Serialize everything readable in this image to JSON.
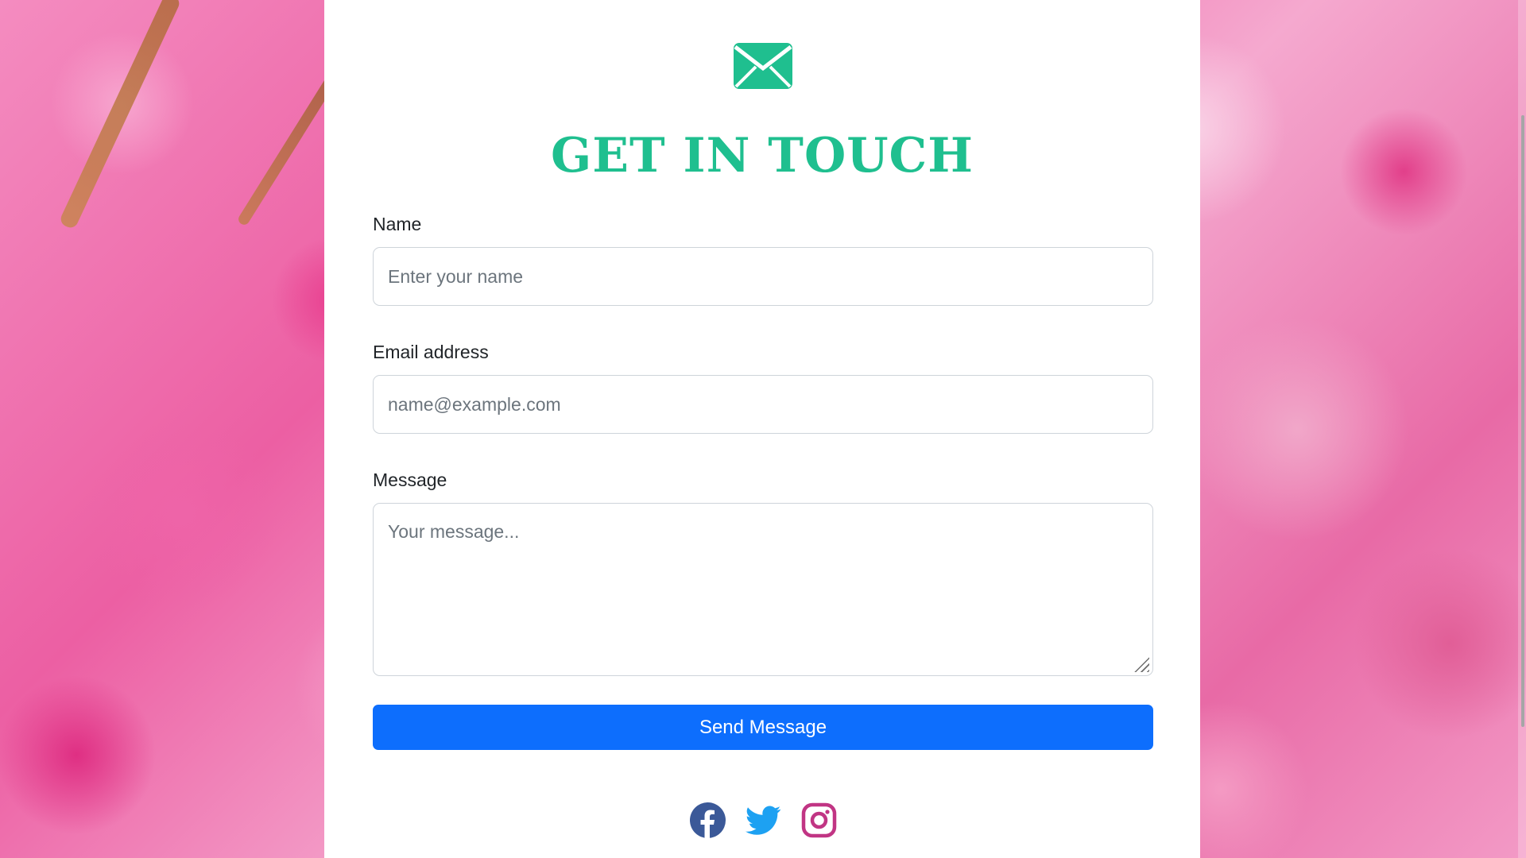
{
  "header": {
    "title": "GET IN TOUCH",
    "icon": "envelope-icon",
    "accent": "#1fbf8f"
  },
  "form": {
    "name": {
      "label": "Name",
      "placeholder": "Enter your name"
    },
    "email": {
      "label": "Email address",
      "placeholder": "name@example.com"
    },
    "message": {
      "label": "Message",
      "placeholder": "Your message..."
    },
    "submit_label": "Send Message",
    "submit_color": "#0d6efd"
  },
  "social": {
    "items": [
      {
        "icon": "facebook-icon",
        "color": "#3b5998"
      },
      {
        "icon": "twitter-icon",
        "color": "#1da1f2"
      },
      {
        "icon": "instagram-icon",
        "color": "#c13584"
      }
    ]
  }
}
